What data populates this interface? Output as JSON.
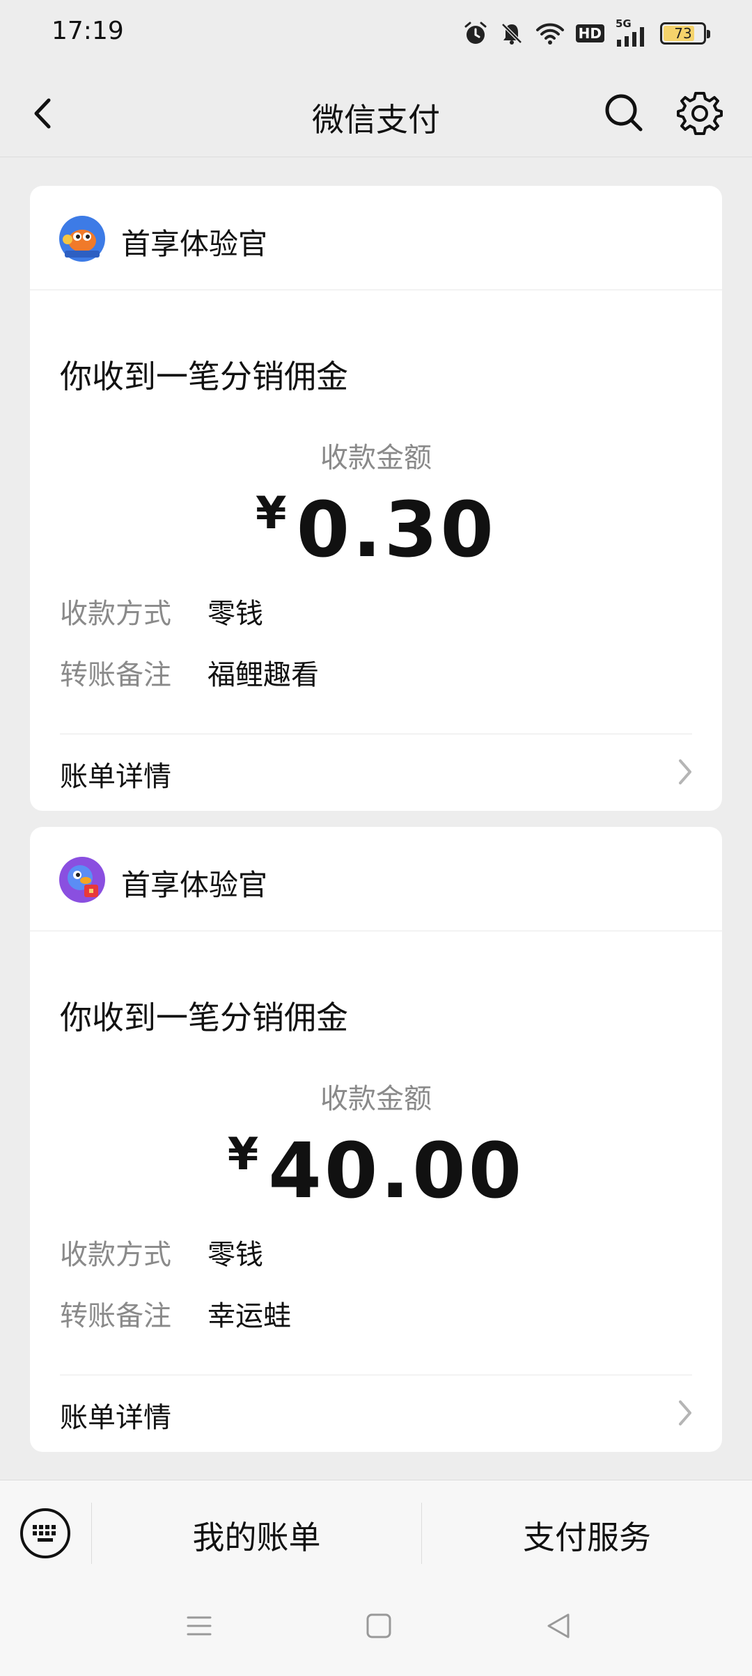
{
  "status_bar": {
    "time": "17:19",
    "network": "5G",
    "hd": "HD",
    "battery": "73",
    "battery_level": 0.73
  },
  "header": {
    "title": "微信支付",
    "icons": [
      "back-icon",
      "search-icon",
      "gear-icon"
    ]
  },
  "messages": [
    {
      "sender": "首享体验官",
      "headline": "你收到一笔分销佣金",
      "amount_label": "收款金额",
      "currency": "¥",
      "amount": "0.30",
      "rows": [
        {
          "key": "收款方式",
          "value": "零钱"
        },
        {
          "key": "转账备注",
          "value": "福鲤趣看"
        }
      ],
      "detail_label": "账单详情"
    },
    {
      "sender": "首享体验官",
      "headline": "你收到一笔分销佣金",
      "amount_label": "收款金额",
      "currency": "¥",
      "amount": "40.00",
      "rows": [
        {
          "key": "收款方式",
          "value": "零钱"
        },
        {
          "key": "转账备注",
          "value": "幸运蛙"
        }
      ],
      "detail_label": "账单详情"
    }
  ],
  "bottom_menu": {
    "items": [
      "我的账单",
      "支付服务"
    ]
  },
  "colors": {
    "background": "#ededed",
    "card": "#ffffff",
    "muted_text": "#8a8a8a",
    "battery": "#f5d36b"
  }
}
